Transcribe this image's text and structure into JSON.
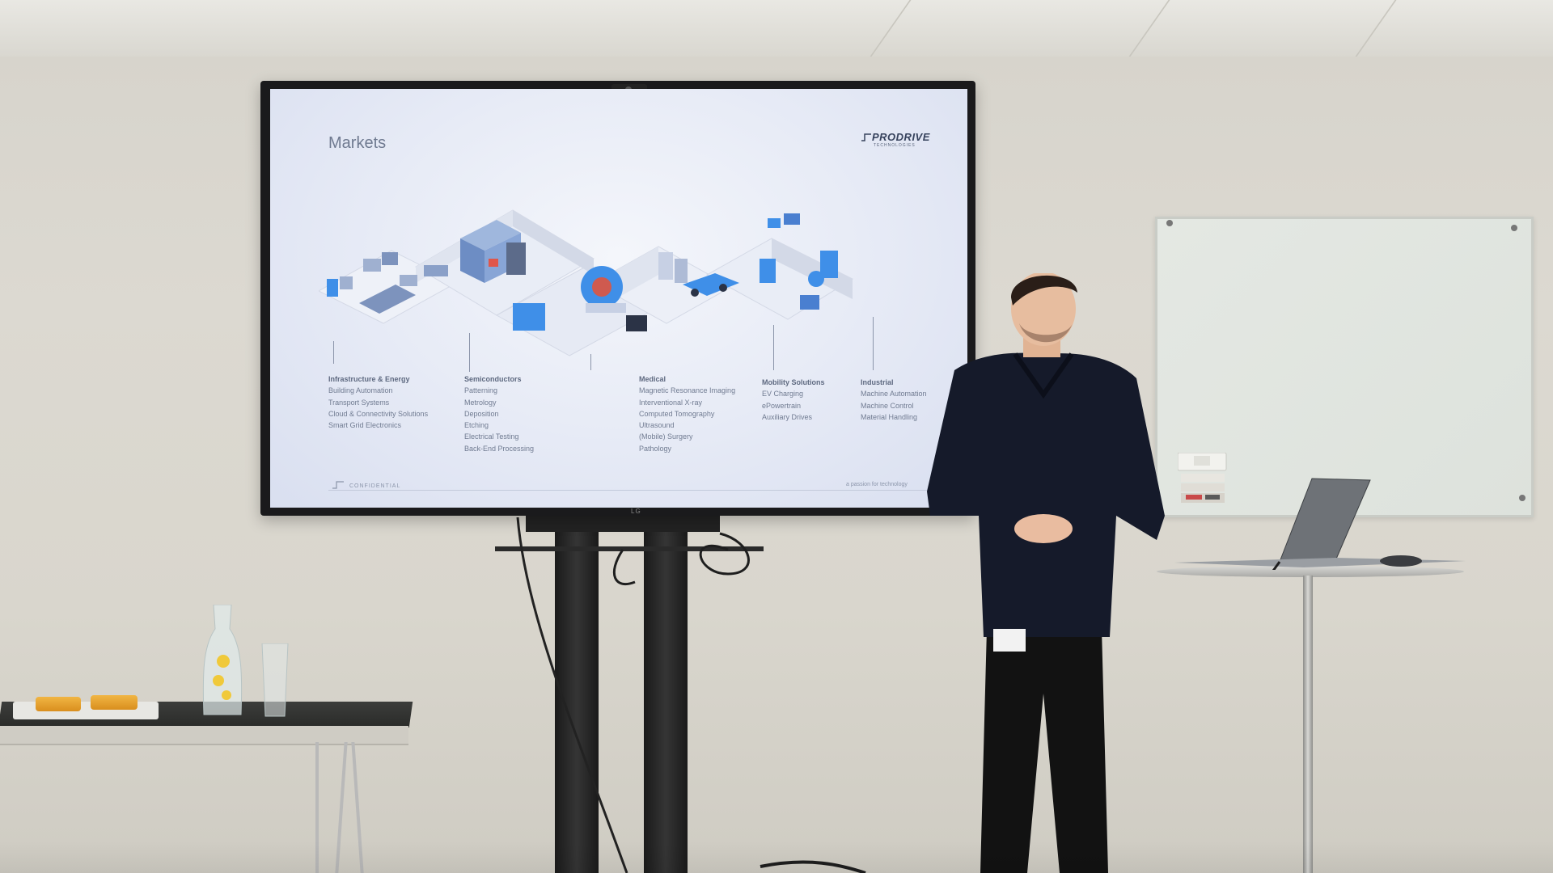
{
  "slide": {
    "title": "Markets",
    "logo_text": "PRODRIVE",
    "logo_sub": "TECHNOLOGIES",
    "confidential": "CONFIDENTIAL",
    "tagline": "a passion for technology"
  },
  "tv_brand": "LG",
  "markets": [
    {
      "heading": "Infrastructure & Energy",
      "items": [
        "Building Automation",
        "Transport Systems",
        "Cloud & Connectivity Solutions",
        "Smart Grid Electronics"
      ]
    },
    {
      "heading": "Semiconductors",
      "items": [
        "Patterning",
        "Metrology",
        "Deposition",
        "Etching",
        "Electrical Testing",
        "Back-End Processing"
      ]
    },
    {
      "heading": "Medical",
      "items": [
        "Magnetic Resonance Imaging",
        "Interventional X-ray",
        "Computed Tomography",
        "Ultrasound",
        "(Mobile) Surgery",
        "Pathology"
      ]
    },
    {
      "heading": "Mobility Solutions",
      "items": [
        "EV Charging",
        "ePowertrain",
        "Auxiliary Drives"
      ]
    },
    {
      "heading": "Industrial",
      "items": [
        "Machine Automation",
        "Machine Control",
        "Material Handling"
      ]
    }
  ],
  "colors": {
    "slide_bg": "#e7ebf6",
    "accent_blue": "#3f8fe8",
    "text_gray": "#707b91",
    "wall": "#d8d5cc",
    "shirt": "#151a2a"
  }
}
